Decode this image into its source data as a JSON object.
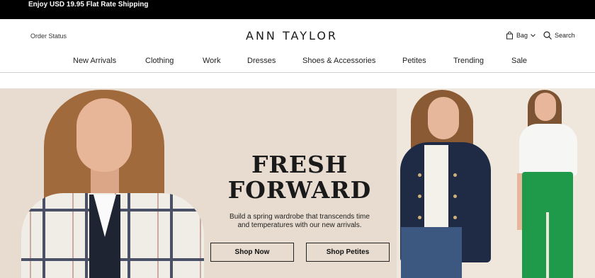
{
  "promo": {
    "text": "Enjoy USD 19.95 Flat Rate Shipping"
  },
  "header": {
    "order_status": "Order Status",
    "logo": "ANN TAYLOR",
    "bag_label": "Bag",
    "search_label": "Search"
  },
  "nav": {
    "items": [
      {
        "label": "New Arrivals"
      },
      {
        "label": "Clothing"
      },
      {
        "label": "Work"
      },
      {
        "label": "Dresses"
      },
      {
        "label": "Shoes & Accessories"
      },
      {
        "label": "Petites"
      },
      {
        "label": "Trending"
      },
      {
        "label": "Sale"
      }
    ]
  },
  "hero": {
    "headline_line1": "FRESH",
    "headline_line2": "FORWARD",
    "subcopy_line1": "Build a spring wardrobe that transcends time",
    "subcopy_line2": "and temperatures with our new arrivals.",
    "cta_primary": "Shop Now",
    "cta_secondary": "Shop Petites"
  },
  "colors": {
    "promo_bg": "#000000",
    "hero_bg": "#e8dcd0",
    "text": "#222222"
  }
}
